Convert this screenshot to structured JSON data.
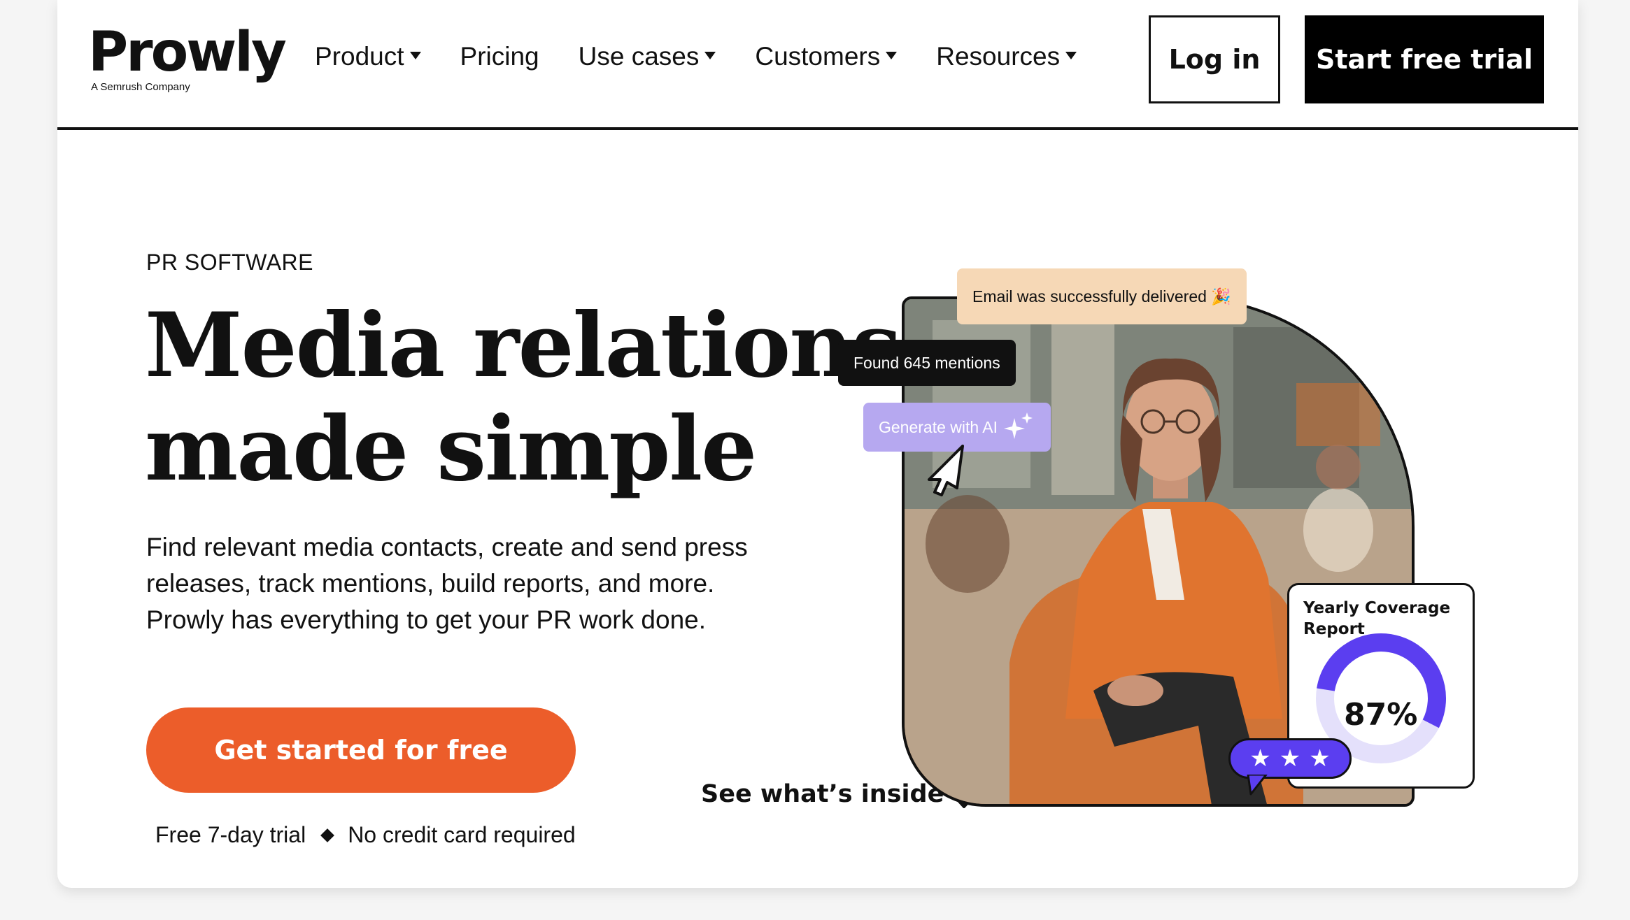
{
  "nav": {
    "logo": "Prowly",
    "logo_sub": "A Semrush Company",
    "items": [
      {
        "label": "Product",
        "dropdown": true
      },
      {
        "label": "Pricing",
        "dropdown": false
      },
      {
        "label": "Use cases",
        "dropdown": true
      },
      {
        "label": "Customers",
        "dropdown": true
      },
      {
        "label": "Resources",
        "dropdown": true
      }
    ],
    "login": "Log in",
    "trial": "Start free trial"
  },
  "hero": {
    "eyebrow": "PR SOFTWARE",
    "headline_1": "Media relations",
    "headline_2": "made simple",
    "description": "Find relevant media contacts, create and send press releases, track mentions, build reports, and more. Prowly has everything to get your PR work done.",
    "cta": "Get started for free",
    "fine_1": "Free 7-day trial",
    "fine_2": "No credit card required",
    "see_inside": "See what’s inside"
  },
  "visual": {
    "email_pill": "Email was successfully delivered 🎉",
    "found_pill": "Found 645 mentions",
    "ai_pill": "Generate with AI",
    "report_title": "Yearly Coverage Report",
    "report_value": "87%",
    "report_percent": 87,
    "rating_stars": 3
  },
  "colors": {
    "accent_orange": "#ec5d2a",
    "gauge_purple": "#5b3ef0",
    "gauge_track": "#e4e0fb",
    "email_pill_bg": "#f6d8b6",
    "ai_pill_bg": "#b6a8f0"
  }
}
